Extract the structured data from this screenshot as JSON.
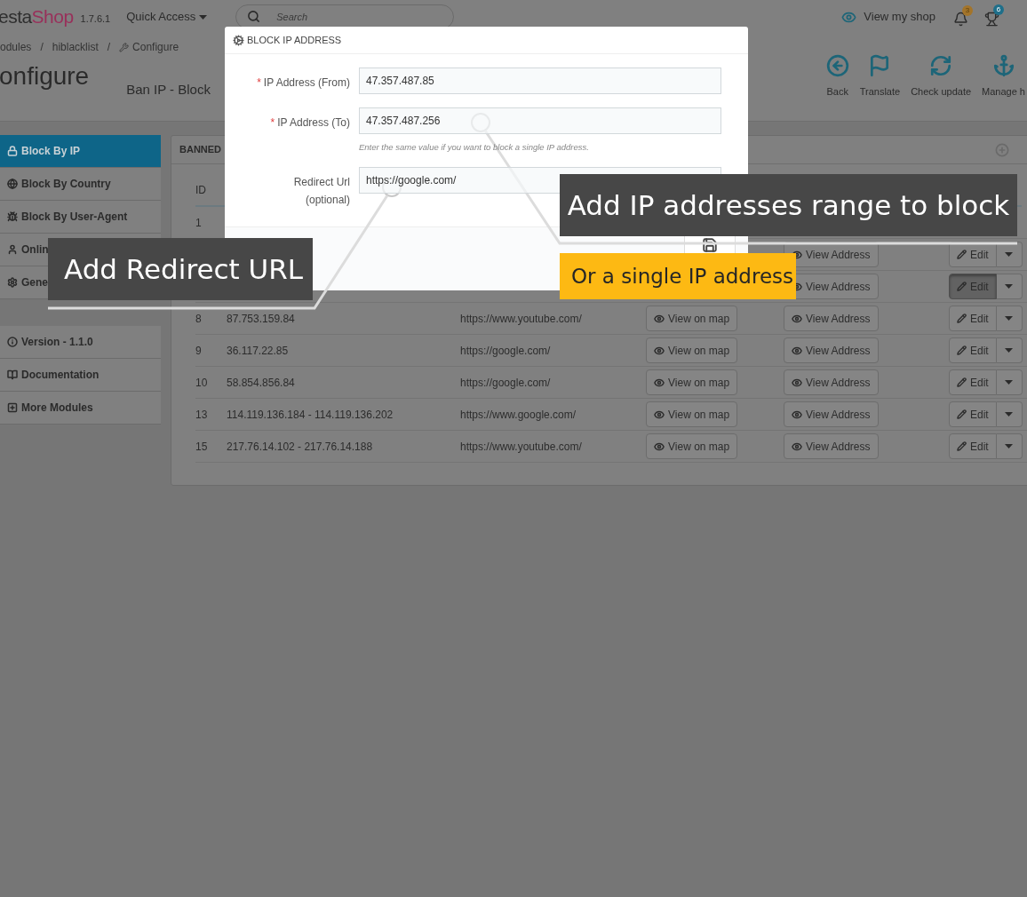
{
  "header": {
    "logo_start": "esta",
    "logo_end": "Shop",
    "version": "1.7.6.1",
    "quick_access": "Quick Access",
    "search": {
      "placeholder": "Search"
    },
    "view_shop": "View my shop",
    "notifications_badge": "3",
    "trophy_badge": "6"
  },
  "breadcrumb": [
    "odules",
    "hiblacklist",
    "Configure"
  ],
  "breadcrumb_separator": "/",
  "page_title": "onfigure",
  "module_title": "Ban IP - Block",
  "toolbar": [
    {
      "label": "Back"
    },
    {
      "label": "Translate"
    },
    {
      "label": "Check update"
    },
    {
      "label": "Manage h"
    }
  ],
  "sidebar": {
    "groups": [
      [
        {
          "label": "Block By IP",
          "selected": true
        },
        {
          "label": "Block By Country",
          "selected": false
        },
        {
          "label": "Block By User-Agent",
          "selected": false
        },
        {
          "label": "Onlin",
          "selected": false
        },
        {
          "label": "Gene",
          "selected": false
        }
      ],
      [
        {
          "label": "Version - 1.1.0",
          "selected": false
        },
        {
          "label": "Documentation",
          "selected": false
        },
        {
          "label": "More Modules",
          "selected": false
        }
      ]
    ]
  },
  "panel": {
    "title": "BANNED",
    "columns": [
      "ID"
    ],
    "rows": [
      {
        "id": "1"
      },
      {
        "view_address": "View Address",
        "edit": "Edit",
        "edit_pressed": false
      },
      {
        "view_address": "View Address",
        "edit": "Edit",
        "edit_pressed": true
      },
      {
        "id": "8",
        "ip": "87.753.159.84",
        "url": "https://www.youtube.com/",
        "view_map": "View on map",
        "view_address": "View Address",
        "edit": "Edit",
        "edit_pressed": false
      },
      {
        "id": "9",
        "ip": "36.117.22.85",
        "url": "https://google.com/",
        "view_map": "View on map",
        "view_address": "View Address",
        "edit": "Edit",
        "edit_pressed": false
      },
      {
        "id": "10",
        "ip": "58.854.856.84",
        "url": "https://google.com/",
        "view_map": "View on map",
        "view_address": "View Address",
        "edit": "Edit",
        "edit_pressed": false
      },
      {
        "id": "13",
        "ip": "114.119.136.184 - 114.119.136.202",
        "url": "https://www.google.com/",
        "view_map": "View on map",
        "view_address": "View Address",
        "edit": "Edit",
        "edit_pressed": false
      },
      {
        "id": "15",
        "ip": "217.76.14.102 - 217.76.14.188",
        "url": "https://www.youtube.com/",
        "view_map": "View on map",
        "view_address": "View Address",
        "edit": "Edit",
        "edit_pressed": false
      }
    ]
  },
  "modal": {
    "title": "BLOCK IP ADDRESS",
    "fields": [
      {
        "label": "IP Address (From)",
        "required_mark": "*",
        "value": "47.357.487.85"
      },
      {
        "label": "IP Address (To)",
        "required_mark": "*",
        "value": "47.357.487.256",
        "help": "Enter the same value if you want to block a single IP address."
      },
      {
        "label": "Redirect Url",
        "sublabel": "(optional)",
        "value": "https://google.com/"
      }
    ]
  },
  "callouts": [
    {
      "kind": "dark",
      "text": "Add IP addresses range to block"
    },
    {
      "kind": "yellow",
      "text": "Or a single IP address"
    },
    {
      "kind": "dark",
      "text": "Add Redirect URL"
    }
  ]
}
